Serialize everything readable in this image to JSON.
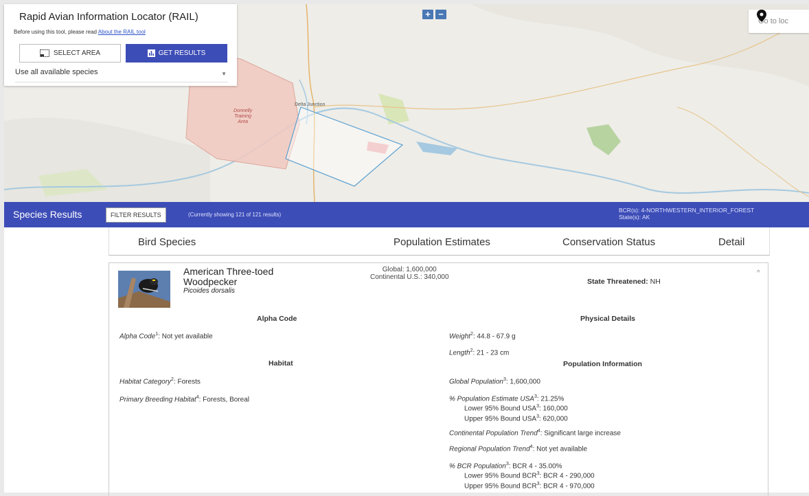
{
  "map": {
    "zoom_in": "+",
    "zoom_out": "−",
    "goto_placeholder": "Go to loc",
    "labels": {
      "area": [
        "Donnelly",
        "Training",
        "Area"
      ],
      "junction": "Delta Junction"
    }
  },
  "panel": {
    "title": "Rapid Avian Information Locator (RAIL)",
    "intro_text": "Before using this tool, please read ",
    "intro_link": "About the RAIL tool",
    "select_area": "SELECT AREA",
    "get_results": "GET RESULTS",
    "species_select": "Use all available species"
  },
  "results_bar": {
    "title": "Species Results",
    "filter": "FILTER RESULTS",
    "count": "(Currently showing 121 of 121 results)",
    "bcr_line": "BCR(s): 4-NORTHWESTERN_INTERIOR_FOREST",
    "state_line": "State(s): AK"
  },
  "columns": [
    "Bird Species",
    "Population Estimates",
    "Conservation Status",
    "Detail"
  ],
  "card": {
    "common_name": "American Three-toed Woodpecker",
    "scientific_name": "Picoides dorsalis",
    "pop_global": "Global: 1,600,000",
    "pop_continental": "Continental U.S.: 340,000",
    "status_label": "State Threatened:",
    "status_value": " NH",
    "chevron": "^",
    "alpha_heading": "Alpha Code",
    "alpha_label": "Alpha Code",
    "alpha_sup": "1",
    "alpha_value": ": Not yet available",
    "habitat_heading": "Habitat",
    "habitat_cat_label": "Habitat Category",
    "habitat_cat_sup": "2",
    "habitat_cat_value": ": Forests",
    "breeding_label": "Primary Breeding Habitat",
    "breeding_sup": "4",
    "breeding_value": ": Forests, Boreal",
    "physical_heading": "Physical Details",
    "weight_label": "Weight",
    "weight_sup": "2",
    "weight_value": ": 44.8 - 67.9 g",
    "length_label": "Length",
    "length_sup": "2",
    "length_value": ": 21 - 23 cm",
    "popinfo_heading": "Population Information",
    "global_pop_label": "Global Population",
    "global_pop_sup": "3",
    "global_pop_value": ": 1,600,000",
    "usa_pct_label": "% Population Estimate USA",
    "usa_pct_sup": "3",
    "usa_pct_value": ": 21.25%",
    "usa_lower_label": "Lower 95% Bound USA",
    "usa_lower_sup": "3",
    "usa_lower_value": ": 160,000",
    "usa_upper_label": "Upper 95% Bound USA",
    "usa_upper_sup": "3",
    "usa_upper_value": ": 620,000",
    "cont_trend_label": "Continental Population Trend",
    "cont_trend_sup": "4",
    "cont_trend_value": ": Significant large increase",
    "reg_trend_label": "Regional Population Trend",
    "reg_trend_sup": "4",
    "reg_trend_value": ": Not yet available",
    "bcr_pct_label": "% BCR Population",
    "bcr_pct_sup": "3",
    "bcr_pct_value": ": BCR 4 - 35.00%",
    "bcr_lower_label": "Lower 95% Bound BCR",
    "bcr_lower_sup": "3",
    "bcr_lower_value": ": BCR 4 - 290,000",
    "bcr_upper_label": "Upper 95% Bound BCR",
    "bcr_upper_sup": "3",
    "bcr_upper_value": ": BCR 4 - 970,000"
  },
  "colors": {
    "brand_blue": "#3d4db7",
    "zoom_blue": "#4a78b5",
    "training_area": "#f2c9c0"
  }
}
